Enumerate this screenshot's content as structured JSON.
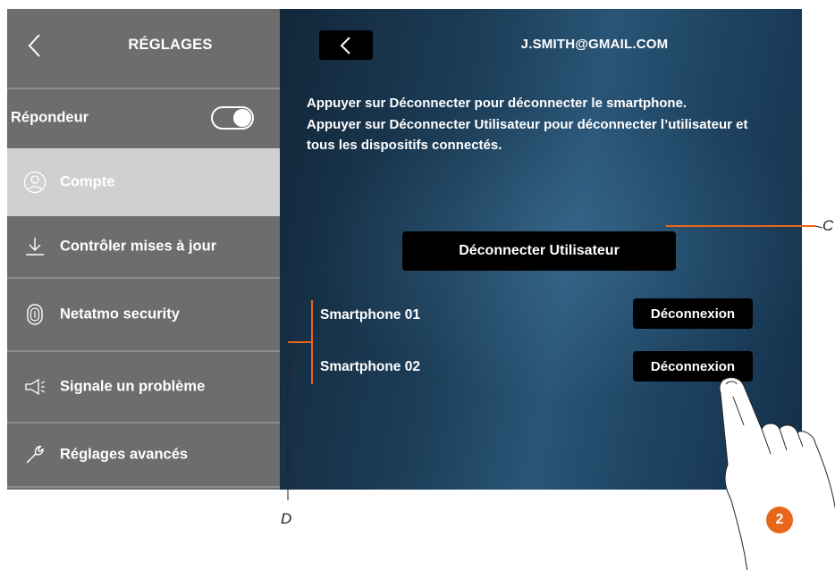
{
  "sidebar": {
    "title": "RÉGLAGES",
    "answering_label": "Répondeur",
    "answering_enabled": true,
    "items": [
      {
        "label": "Compte",
        "icon": "user-circle-icon",
        "selected": true
      },
      {
        "label": "Contrôler mises à jour",
        "icon": "download-icon",
        "selected": false
      },
      {
        "label": "Netatmo security",
        "icon": "fingerprint-shield-icon",
        "selected": false
      },
      {
        "label": "Signale un problème",
        "icon": "megaphone-icon",
        "selected": false
      },
      {
        "label": "Réglages avancés",
        "icon": "wrench-icon",
        "selected": false
      }
    ]
  },
  "main": {
    "account_email": "J.SMITH@GMAIL.COM",
    "info_lines": [
      "Appuyer sur Déconnecter pour déconnecter le smartphone.",
      "Appuyer sur Déconnecter Utilisateur pour déconnecter l’utilisateur et tous les dispositifs connectés."
    ],
    "disconnect_user_label": "Déconnecter Utilisateur",
    "devices": [
      {
        "name": "Smartphone 01",
        "button": "Déconnexion"
      },
      {
        "name": "Smartphone 02",
        "button": "Déconnexion"
      }
    ]
  },
  "annotations": {
    "callout_c": "C",
    "callout_d": "D",
    "step_number": "2"
  },
  "colors": {
    "sidebar_bg": "#6d6d6d",
    "selected_bg": "#d0d0d0",
    "accent_orange": "#e8671b",
    "button_bg": "#000000"
  }
}
